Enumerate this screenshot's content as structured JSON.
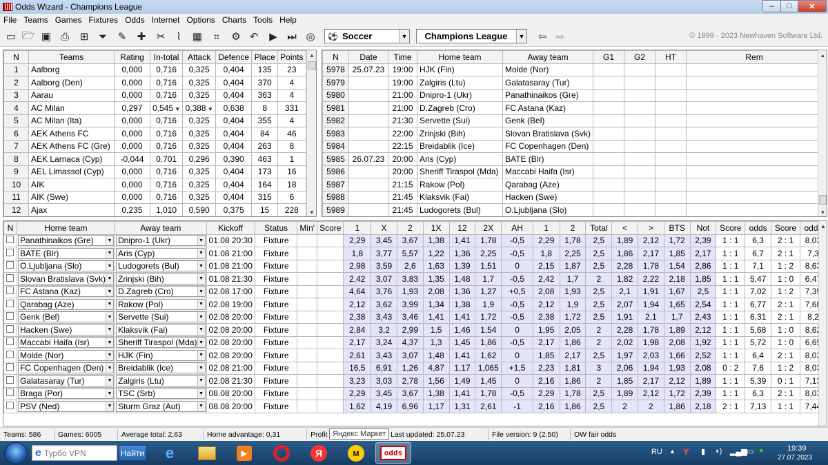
{
  "window": {
    "title": "Odds Wizard - Champions League",
    "min": "–",
    "max": "□",
    "close": "✕"
  },
  "menu": [
    "File",
    "Teams",
    "Games",
    "Fixtures",
    "Odds",
    "Internet",
    "Options",
    "Charts",
    "Tools",
    "Help"
  ],
  "toolbar": {
    "sport": "Soccer",
    "league": "Champions League",
    "copyright": "© 1999 - 2023 Newhaven Software Ltd."
  },
  "teams": {
    "headers": [
      "N",
      "Teams",
      "Rating",
      "In-total",
      "Attack",
      "Defence",
      "Place",
      "Points"
    ],
    "rows": [
      [
        "1",
        "Aalborg",
        "0,000",
        "0,716",
        "0,325",
        "0,404",
        "135",
        "23"
      ],
      [
        "2",
        "Aalborg (Den)",
        "0,000",
        "0,716",
        "0,325",
        "0,404",
        "370",
        "4"
      ],
      [
        "3",
        "Aarau",
        "0,000",
        "0,716",
        "0,325",
        "0,404",
        "363",
        "4"
      ],
      [
        "4",
        "AC Milan",
        "0,297",
        "0,545",
        "0,388",
        "0,638",
        "8",
        "331"
      ],
      [
        "5",
        "AC Milan (Ita)",
        "0,000",
        "0,716",
        "0,325",
        "0,404",
        "355",
        "4"
      ],
      [
        "6",
        "AEK Athens FC",
        "0,000",
        "0,716",
        "0,325",
        "0,404",
        "84",
        "46"
      ],
      [
        "7",
        "AEK Athens FC (Gre)",
        "0,000",
        "0,716",
        "0,325",
        "0,404",
        "263",
        "8"
      ],
      [
        "8",
        "AEK Larnaca (Cyp)",
        "-0,044",
        "0,701",
        "0,296",
        "0,390",
        "463",
        "1"
      ],
      [
        "9",
        "AEL Limassol (Cyp)",
        "0,000",
        "0,716",
        "0,325",
        "0,404",
        "173",
        "16"
      ],
      [
        "10",
        "AIK",
        "0,000",
        "0,716",
        "0,325",
        "0,404",
        "164",
        "18"
      ],
      [
        "11",
        "AIK (Swe)",
        "0,000",
        "0,716",
        "0,325",
        "0,404",
        "315",
        "6"
      ],
      [
        "12",
        "Ajax",
        "0,235",
        "1,010",
        "0,590",
        "0,375",
        "15",
        "228"
      ]
    ]
  },
  "games": {
    "headers": [
      "N",
      "Date",
      "Time",
      "Home team",
      "Away team",
      "G1",
      "G2",
      "HT",
      "Rem"
    ],
    "rows": [
      [
        "5978",
        "25.07.23",
        "19:00",
        "HJK (Fin)",
        "Molde (Nor)"
      ],
      [
        "5979",
        "",
        "19:00",
        "Zalgiris (Ltu)",
        "Galatasaray (Tur)"
      ],
      [
        "5980",
        "",
        "21:00",
        "Dnipro-1 (Ukr)",
        "Panathinaikos (Gre)"
      ],
      [
        "5981",
        "",
        "21:00",
        "D.Zagreb (Cro)",
        "FC Astana (Kaz)"
      ],
      [
        "5982",
        "",
        "21:30",
        "Servette (Sui)",
        "Genk (Bel)"
      ],
      [
        "5983",
        "",
        "22:00",
        "Zrinjski (Bih)",
        "Slovan Bratislava (Svk)"
      ],
      [
        "5984",
        "",
        "22:15",
        "Breidablik (Ice)",
        "FC Copenhagen (Den)"
      ],
      [
        "5985",
        "26.07.23",
        "20:00",
        "Aris (Cyp)",
        "BATE (Blr)"
      ],
      [
        "5986",
        "",
        "20:00",
        "Sheriff Tiraspol (Mda)",
        "Maccabi Haifa (Isr)"
      ],
      [
        "5987",
        "",
        "21:15",
        "Rakow (Pol)",
        "Qarabag (Aze)"
      ],
      [
        "5988",
        "",
        "21:45",
        "Klaksvik (Fai)",
        "Hacken (Swe)"
      ],
      [
        "5989",
        "",
        "21:45",
        "Ludogorets (Bul)",
        "O.Ljubljana (Slo)"
      ]
    ]
  },
  "fixtures": {
    "headers": [
      "N",
      "Home team",
      "Away team",
      "Kickoff",
      "Status",
      "Min'",
      "Score",
      "1",
      "X",
      "2",
      "1X",
      "12",
      "2X",
      "AH",
      "1",
      "2",
      "Total",
      "<",
      ">",
      "BTS",
      "Not",
      "Score",
      "odds",
      "Score",
      "odds"
    ],
    "rows": [
      [
        "Panathinaikos (Gre)",
        "Dnipro-1 (Ukr)",
        "01.08 20:30",
        "Fixture",
        "2,29",
        "3,45",
        "3,67",
        "1,38",
        "1,41",
        "1,78",
        "-0,5",
        "2,29",
        "1,78",
        "2,5",
        "1,89",
        "2,12",
        "1,72",
        "2,39",
        "1 : 1",
        "6,3",
        "2 : 1",
        "8,03"
      ],
      [
        "BATE (Blr)",
        "Aris (Cyp)",
        "01.08 21:00",
        "Fixture",
        "1,8",
        "3,77",
        "5,57",
        "1,22",
        "1,36",
        "2,25",
        "-0,5",
        "1,8",
        "2,25",
        "2,5",
        "1,86",
        "2,17",
        "1,85",
        "2,17",
        "1 : 1",
        "6,7",
        "2 : 1",
        "7,3"
      ],
      [
        "O.Ljubljana (Slo)",
        "Ludogorets (Bul)",
        "01.08 21:00",
        "Fixture",
        "2,98",
        "3,59",
        "2,6",
        "1,63",
        "1,39",
        "1,51",
        "0",
        "2,15",
        "1,87",
        "2,5",
        "2,28",
        "1,78",
        "1,54",
        "2,86",
        "1 : 1",
        "7,1",
        "1 : 2",
        "8,63"
      ],
      [
        "Slovan Bratislava (Svk)",
        "Zrinjski (Bih)",
        "01.08 21:30",
        "Fixture",
        "2,42",
        "3,07",
        "3,83",
        "1,35",
        "1,48",
        "1,7",
        "-0,5",
        "2,42",
        "1,7",
        "2",
        "1,82",
        "2,22",
        "2,18",
        "1,85",
        "1 : 1",
        "5,47",
        "1 : 0",
        "6,47"
      ],
      [
        "FC Astana (Kaz)",
        "D.Zagreb (Cro)",
        "02.08 17:00",
        "Fixture",
        "4,64",
        "3,76",
        "1,93",
        "2,08",
        "1,36",
        "1,27",
        "+0,5",
        "2,08",
        "1,93",
        "2,5",
        "2,1",
        "1,91",
        "1,67",
        "2,5",
        "1 : 1",
        "7,02",
        "1 : 2",
        "7,39"
      ],
      [
        "Qarabag (Aze)",
        "Rakow (Pol)",
        "02.08 19:00",
        "Fixture",
        "2,12",
        "3,62",
        "3,99",
        "1,34",
        "1,38",
        "1,9",
        "-0,5",
        "2,12",
        "1,9",
        "2,5",
        "2,07",
        "1,94",
        "1,65",
        "2,54",
        "1 : 1",
        "6,77",
        "2 : 1",
        "7,68"
      ],
      [
        "Genk (Bel)",
        "Servette (Sui)",
        "02.08 20:00",
        "Fixture",
        "2,38",
        "3,43",
        "3,46",
        "1,41",
        "1,41",
        "1,72",
        "-0,5",
        "2,38",
        "1,72",
        "2,5",
        "1,91",
        "2,1",
        "1,7",
        "2,43",
        "1 : 1",
        "6,31",
        "2 : 1",
        "8,2"
      ],
      [
        "Hacken (Swe)",
        "Klaksvik (Fai)",
        "02.08 20:00",
        "Fixture",
        "2,84",
        "3,2",
        "2,99",
        "1,5",
        "1,46",
        "1,54",
        "0",
        "1,95",
        "2,05",
        "2",
        "2,28",
        "1,78",
        "1,89",
        "2,12",
        "1 : 1",
        "5,68",
        "1 : 0",
        "8,62"
      ],
      [
        "Maccabi Haifa (Isr)",
        "Sheriff Tiraspol (Mda)",
        "02.08 20:00",
        "Fixture",
        "2,17",
        "3,24",
        "4,37",
        "1,3",
        "1,45",
        "1,86",
        "-0,5",
        "2,17",
        "1,86",
        "2",
        "2,02",
        "1,98",
        "2,08",
        "1,92",
        "1 : 1",
        "5,72",
        "1 : 0",
        "6,65"
      ],
      [
        "Molde (Nor)",
        "HJK (Fin)",
        "02.08 20:00",
        "Fixture",
        "2,61",
        "3,43",
        "3,07",
        "1,48",
        "1,41",
        "1,62",
        "0",
        "1,85",
        "2,17",
        "2,5",
        "1,97",
        "2,03",
        "1,66",
        "2,52",
        "1 : 1",
        "6,4",
        "2 : 1",
        "8,03"
      ],
      [
        "FC Copenhagen (Den)",
        "Breidablik (Ice)",
        "02.08 21:00",
        "Fixture",
        "16,5",
        "6,91",
        "1,26",
        "4,87",
        "1,17",
        "1,065",
        "+1,5",
        "2,23",
        "1,81",
        "3",
        "2,06",
        "1,94",
        "1,93",
        "2,08",
        "0 : 2",
        "7,6",
        "1 : 2",
        "8,03"
      ],
      [
        "Galatasaray (Tur)",
        "Zalgiris (Ltu)",
        "02.08 21:30",
        "Fixture",
        "3,23",
        "3,03",
        "2,78",
        "1,56",
        "1,49",
        "1,45",
        "0",
        "2,16",
        "1,86",
        "2",
        "1,85",
        "2,17",
        "2,12",
        "1,89",
        "1 : 1",
        "5,39",
        "0 : 1",
        "7,13"
      ],
      [
        "Braga (Por)",
        "TSC (Srb)",
        "08.08 20:00",
        "Fixture",
        "2,29",
        "3,45",
        "3,67",
        "1,38",
        "1,41",
        "1,78",
        "-0,5",
        "2,29",
        "1,78",
        "2,5",
        "1,89",
        "2,12",
        "1,72",
        "2,39",
        "1 : 1",
        "6,3",
        "2 : 1",
        "8,03"
      ],
      [
        "PSV (Ned)",
        "Sturm Graz (Aut)",
        "08.08 20:00",
        "Fixture",
        "1,62",
        "4,19",
        "6,96",
        "1,17",
        "1,31",
        "2,61",
        "-1",
        "2,16",
        "1,86",
        "2,5",
        "2",
        "2",
        "1,86",
        "2,18",
        "2 : 1",
        "7,13",
        "1 : 1",
        "7,44"
      ]
    ]
  },
  "status": {
    "teams": "Teams: 586",
    "games": "Games: 6005",
    "avg": "Average total: 2,63",
    "home_adv": "Home advantage: 0,31",
    "profit": "Profit",
    "tooltip": "Яндекс Маркет",
    "updated": "Last updated: 25.07.23",
    "version": "File version: 9 (2.50)",
    "fair": "OW fair odds"
  },
  "taskbar": {
    "browser": "Турбо VPN",
    "go": "Найти",
    "app_label": "odds",
    "lang": "RU",
    "time": "19:39",
    "date": "27.07.2023"
  },
  "colors": {
    "odds_bg": "#e4e4fa",
    "titlebar": "#b6cde9",
    "close": "#c6412d"
  }
}
